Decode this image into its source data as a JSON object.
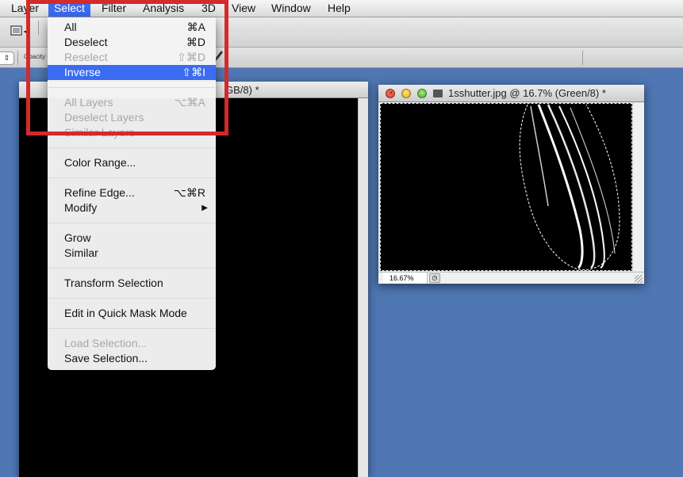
{
  "colors": {
    "desktop": "#4f77b3",
    "menu_highlight": "#3b6bf0",
    "annotation_box": "#d42a2a"
  },
  "menubar": {
    "items": [
      "Layer",
      "Select",
      "Filter",
      "Analysis",
      "3D",
      "View",
      "Window",
      "Help"
    ],
    "active": "Select"
  },
  "toolbar": {
    "tool_icon": "marquee-icon",
    "opacity_label": "Opacity",
    "stepper_glyph": "⇕"
  },
  "select_menu": {
    "items": [
      {
        "label": "All",
        "shortcut": "⌘A"
      },
      {
        "label": "Deselect",
        "shortcut": "⌘D"
      },
      {
        "label": "Reselect",
        "shortcut": "⇧⌘D",
        "disabled": true
      },
      {
        "label": "Inverse",
        "shortcut": "⇧⌘I",
        "selected": true
      },
      {
        "label": "All Layers",
        "shortcut": "⌥⌘A",
        "disabled": true
      },
      {
        "label": "Deselect Layers",
        "shortcut": "",
        "disabled": true
      },
      {
        "label": "Similar Layers",
        "shortcut": "",
        "disabled": true
      },
      {
        "label": "Color Range...",
        "shortcut": ""
      },
      {
        "label": "Refine Edge...",
        "shortcut": "⌥⌘R"
      },
      {
        "label": "Modify",
        "shortcut": "▶"
      },
      {
        "label": "Grow",
        "shortcut": ""
      },
      {
        "label": "Similar",
        "shortcut": ""
      },
      {
        "label": "Transform Selection",
        "shortcut": ""
      },
      {
        "label": "Edit in Quick Mask Mode",
        "shortcut": ""
      },
      {
        "label": "Load Selection...",
        "shortcut": "",
        "disabled": true
      },
      {
        "label": "Save Selection...",
        "shortcut": ""
      }
    ]
  },
  "doc_left": {
    "title_fragment": "GB/8) *"
  },
  "doc_right": {
    "title": "1sshutter.jpg @ 16.7% (Green/8) *",
    "zoom": "16.67%"
  }
}
